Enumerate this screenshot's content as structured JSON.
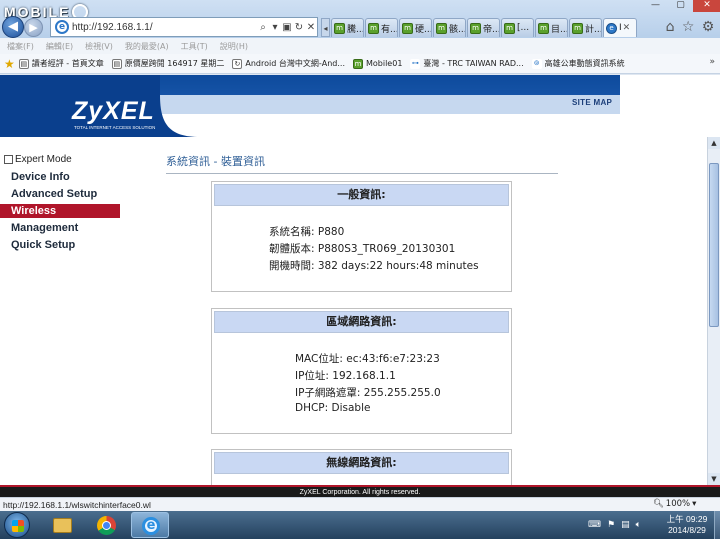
{
  "watermark": {
    "text": "MOBILE"
  },
  "browser": {
    "url": "http://192.168.1.1/",
    "window_controls": [
      "—",
      "▢",
      "✕"
    ],
    "tabs": [
      {
        "label": "騰...",
        "active": false
      },
      {
        "label": "有...",
        "active": false
      },
      {
        "label": "硬...",
        "active": false
      },
      {
        "label": "骸...",
        "active": false
      },
      {
        "label": "帝...",
        "active": false
      },
      {
        "label": "[...",
        "active": false
      },
      {
        "label": "目...",
        "active": false
      },
      {
        "label": "計...",
        "active": false
      },
      {
        "label": "I",
        "active": true
      }
    ],
    "menu": [
      "檔案(F)",
      "編輯(E)",
      "檢視(V)",
      "我的最愛(A)",
      "工具(T)",
      "說明(H)"
    ],
    "favorites": [
      {
        "icon": "document-icon",
        "label": "讀者經評 - 首頁文章"
      },
      {
        "icon": "document-icon",
        "label": "原價屋跨閱 164917 星期二"
      },
      {
        "icon": "refresh-icon",
        "label": "Android 台灣中文網-And..."
      },
      {
        "icon": "mobile01-icon",
        "label": "Mobile01"
      },
      {
        "icon": "signal-icon",
        "label": "臺灣 - TRC TAIWAN RAD..."
      },
      {
        "icon": "bus-icon",
        "label": "高雄公車動態資訊系統"
      }
    ]
  },
  "router": {
    "brand": "ZyXEL",
    "tagline": "TOTAL INTERNET ACCESS SOLUTION",
    "site_map": "SITE MAP",
    "expert_mode": "Expert Mode",
    "nav": [
      {
        "label": "Device Info",
        "active": false
      },
      {
        "label": "Advanced Setup",
        "active": false
      },
      {
        "label": "Wireless",
        "active": true
      },
      {
        "label": "Management",
        "active": false
      },
      {
        "label": "Quick Setup",
        "active": false
      }
    ],
    "page_title": "系統資訊 - 裝置資訊",
    "general": {
      "title": "一般資訊:",
      "rows": [
        "系統名稱: P880",
        "韌體版本: P880S3_TR069_20130301",
        "開機時間: 382 days:22 hours:48 minutes"
      ]
    },
    "lan": {
      "title": "區域網路資訊:",
      "rows": [
        "MAC位址: ec:43:f6:e7:23:23",
        "IP位址: 192.168.1.1",
        "IP子網路遮罩: 255.255.255.0",
        "DHCP: Disable"
      ]
    },
    "wifi": {
      "title": "無線網路資訊:"
    },
    "footer": "ZyXEL Corporation. All rights reserved."
  },
  "statusbar": {
    "url": "http://192.168.1.1/wlswitchinterface0.wl",
    "zoom": "100%"
  },
  "taskbar": {
    "time": "上午 09:29",
    "date": "2014/8/29"
  }
}
